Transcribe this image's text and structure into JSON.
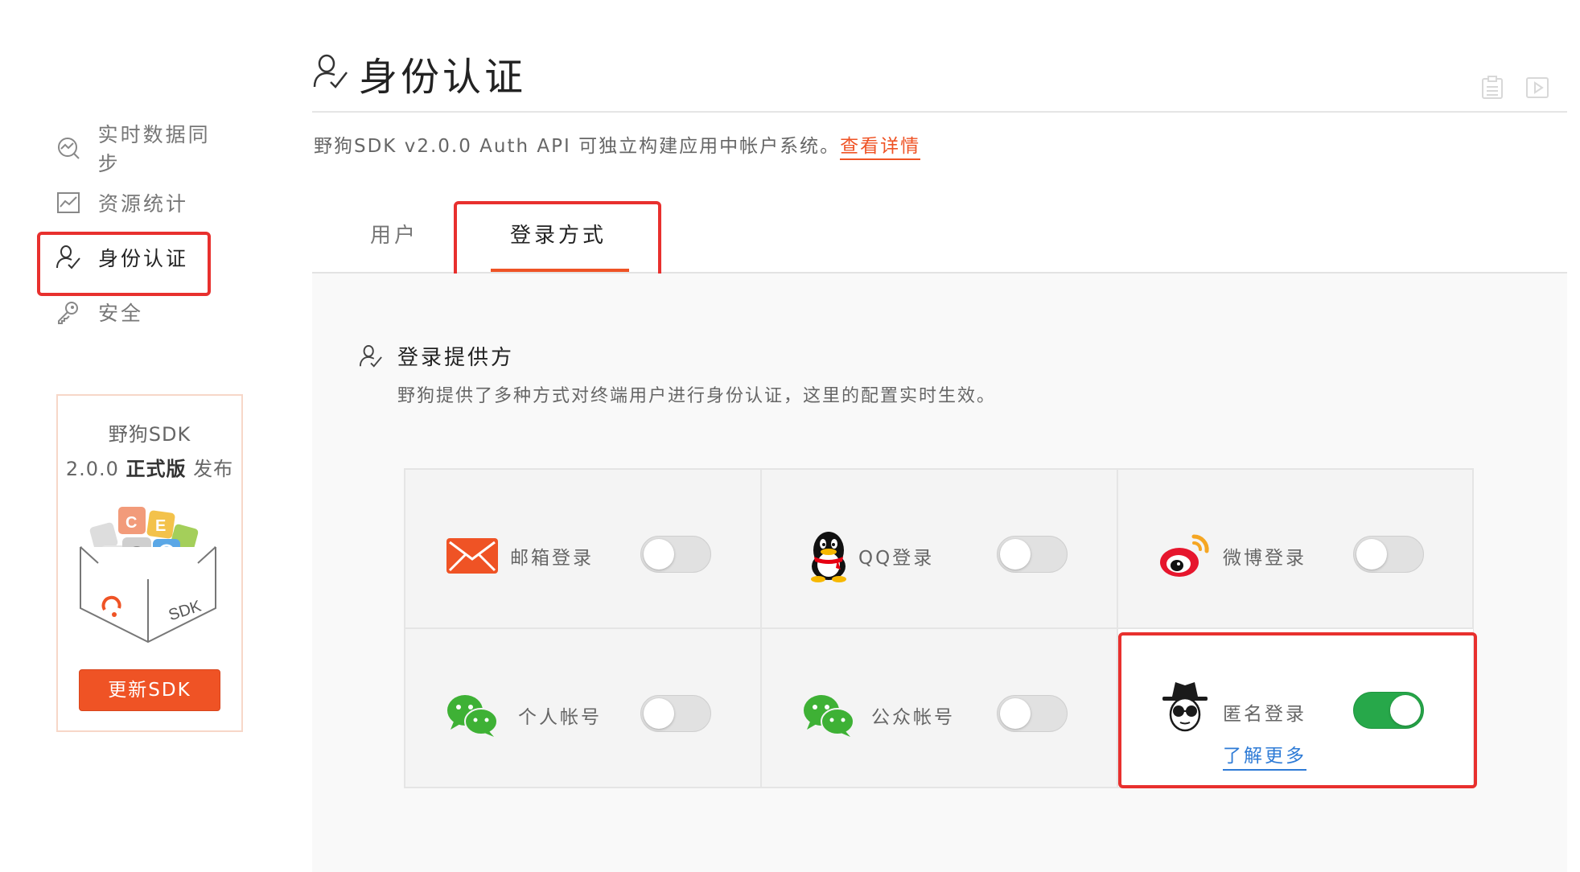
{
  "sidebar": {
    "items": [
      {
        "label": "实时数据同步",
        "icon": "realtime-sync-icon",
        "active": false
      },
      {
        "label": "资源统计",
        "icon": "stats-chart-icon",
        "active": false
      },
      {
        "label": "身份认证",
        "icon": "user-auth-icon",
        "active": true
      },
      {
        "label": "安全",
        "icon": "key-icon",
        "active": false
      }
    ],
    "promo": {
      "line1": "野狗SDK",
      "version": "2.0.0",
      "edition": "正式版",
      "release": "发布",
      "box_label": "SDK",
      "button_label": "更新SDK"
    }
  },
  "header": {
    "title": "身份认证",
    "subtitle": "野狗SDK v2.0.0 Auth API 可独立构建应用中帐户系统。",
    "subtitle_link": "查看详情"
  },
  "tabs": [
    {
      "label": "用户",
      "active": false
    },
    {
      "label": "登录方式",
      "active": true
    }
  ],
  "section": {
    "title": "登录提供方",
    "description": "野狗提供了多种方式对终端用户进行身份认证，这里的配置实时生效。"
  },
  "providers": [
    {
      "name": "邮箱登录",
      "icon": "email-icon",
      "enabled": false
    },
    {
      "name": "QQ登录",
      "icon": "qq-penguin-icon",
      "enabled": false
    },
    {
      "name": "微博登录",
      "icon": "weibo-icon",
      "enabled": false
    },
    {
      "name": "个人帐号",
      "icon": "wechat-icon",
      "enabled": false
    },
    {
      "name": "公众帐号",
      "icon": "wechat-icon",
      "enabled": false
    },
    {
      "name": "匿名登录",
      "icon": "anonymous-spy-icon",
      "enabled": true,
      "link": "了解更多"
    }
  ],
  "colors": {
    "accent": "#ef5325",
    "highlight_border": "#e8302e",
    "toggle_on": "#27a84a",
    "link_blue": "#2e7bd6"
  }
}
